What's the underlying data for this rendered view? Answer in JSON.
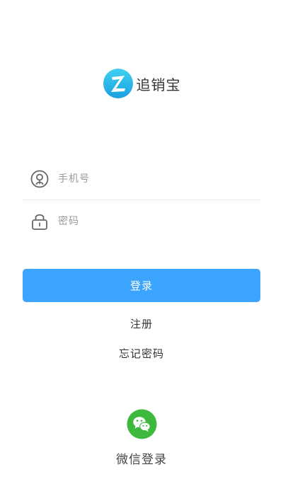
{
  "brand": {
    "name": "追销宝",
    "logo_icon": "z-logo-icon",
    "logo_color_top": "#3fd0f0",
    "logo_color_bottom": "#1aa0e0"
  },
  "login_form": {
    "phone_placeholder": "手机号",
    "phone_icon": "user-icon",
    "password_placeholder": "密码",
    "password_icon": "lock-icon",
    "login_label": "登录",
    "accent_color": "#3aa4fe"
  },
  "links": {
    "register": "注册",
    "forgot_password": "忘记密码"
  },
  "wechat": {
    "label": "微信登录",
    "icon": "wechat-icon",
    "color": "#3dba3d"
  }
}
